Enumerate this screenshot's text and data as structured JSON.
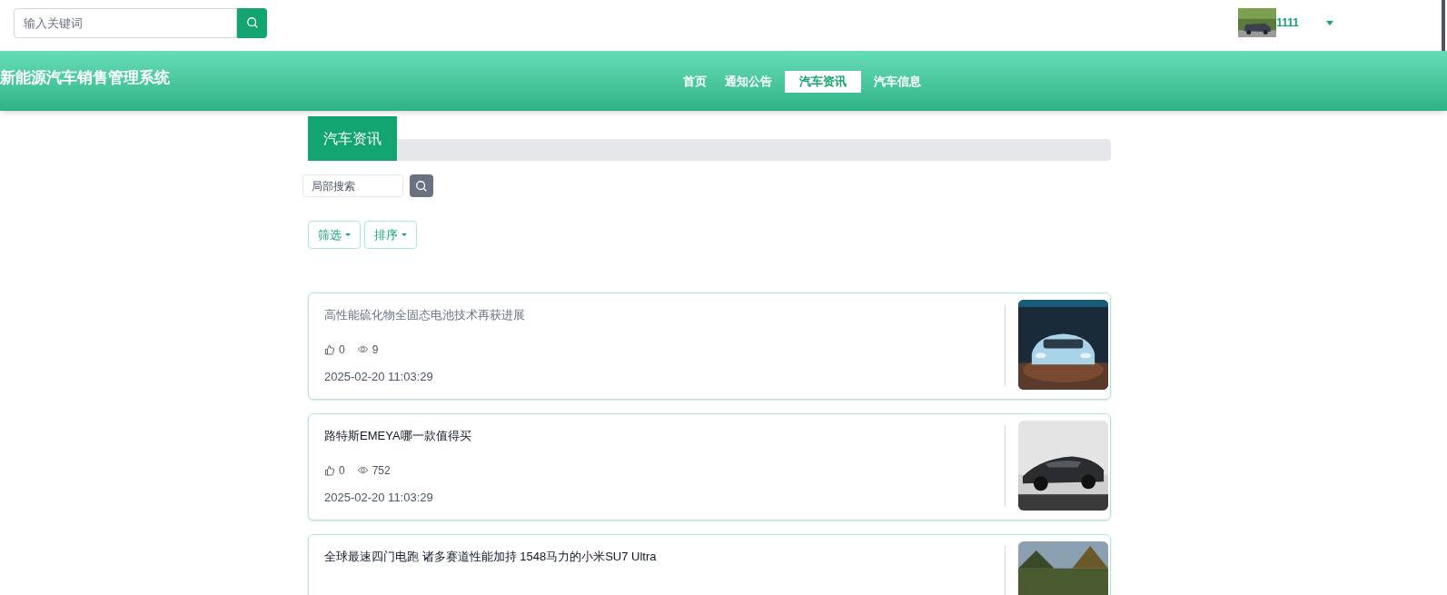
{
  "top_search": {
    "placeholder": "输入关键词"
  },
  "user": {
    "name": "1111"
  },
  "header": {
    "title": "新能源汽车销售管理系统"
  },
  "nav": [
    {
      "label": "首页",
      "selected": false
    },
    {
      "label": "通知公告",
      "selected": false
    },
    {
      "label": "汽车资讯",
      "selected": true
    },
    {
      "label": "汽车信息",
      "selected": false
    }
  ],
  "section_tab": {
    "label": "汽车资讯"
  },
  "local_search": {
    "placeholder": "局部搜索"
  },
  "filters": [
    {
      "label": "筛选"
    },
    {
      "label": "排序"
    }
  ],
  "articles": [
    {
      "title": "高性能硫化物全固态电池技术再获进展",
      "hovered": true,
      "likes": "0",
      "views": "9",
      "date": "2025-02-20 11:03:29"
    },
    {
      "title": "路特斯EMEYA哪一款值得买",
      "hovered": false,
      "likes": "0",
      "views": "752",
      "date": "2025-02-20 11:03:29"
    },
    {
      "title": "全球最速四门电跑 诸多赛道性能加持 1548马力的小米SU7 Ultra",
      "hovered": false
    }
  ]
}
